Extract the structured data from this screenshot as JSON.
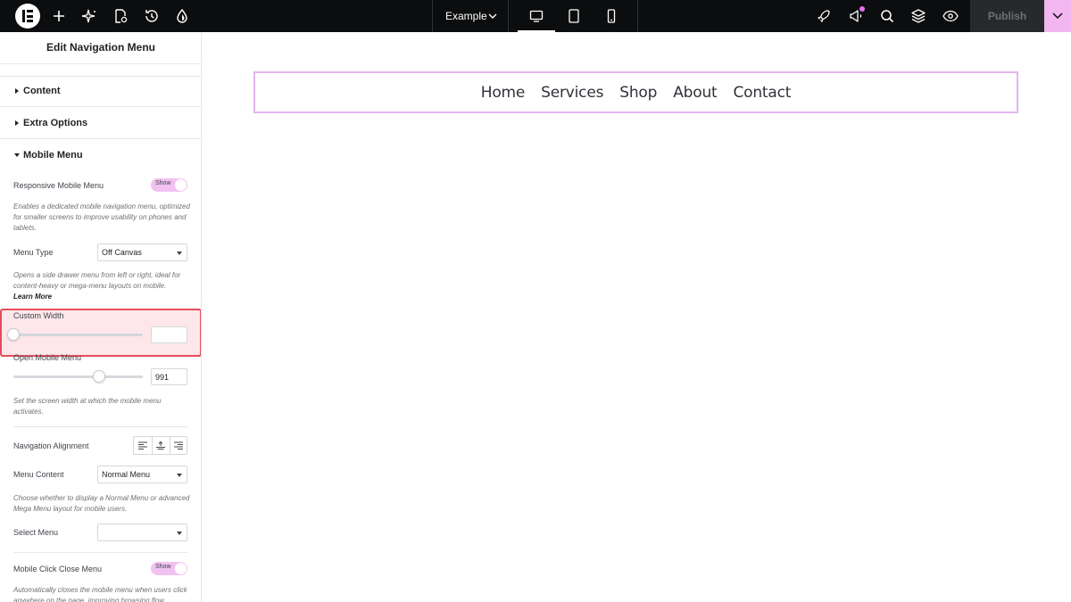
{
  "topbar": {
    "site_name": "Example",
    "publish_label": "Publish",
    "icons": [
      "elementor-logo",
      "add-icon",
      "ai-sparkle-icon",
      "page-settings-icon",
      "history-icon",
      "theme-style-icon",
      "devices: desktop, tablet, mobile",
      "launchpad-icon",
      "announcements-icon",
      "search-icon",
      "structure-icon",
      "preview-icon",
      "chevron-down-icon"
    ],
    "active_device": "desktop",
    "notification_dot_color": "#e86eec"
  },
  "panel": {
    "title": "Edit Navigation Menu",
    "sections": [
      {
        "label": "Content",
        "expanded": false
      },
      {
        "label": "Extra Options",
        "expanded": false
      },
      {
        "label": "Mobile Menu",
        "expanded": true
      }
    ],
    "responsive_mobile_menu": {
      "label": "Responsive Mobile Menu",
      "toggle": "Show",
      "description": "Enables a dedicated mobile navigation menu, optimized for smaller screens to improve usability on phones and tablets."
    },
    "menu_type": {
      "label": "Menu Type",
      "value": "Off Canvas",
      "description": "Opens a side drawer menu from left or right, ideal for content-heavy or mega-menu layouts on mobile.",
      "learn_more": "Learn More"
    },
    "custom_width": {
      "label": "Custom Width",
      "value": "",
      "slider_fraction": 0.0
    },
    "open_mobile_menu": {
      "label": "Open Mobile Menu",
      "value": "991",
      "slider_fraction": 0.66,
      "description": "Set the screen width at which the mobile menu activates."
    },
    "navigation_alignment": {
      "label": "Navigation Alignment",
      "options": [
        "align-left-icon",
        "align-center-icon",
        "align-right-icon"
      ]
    },
    "menu_content": {
      "label": "Menu Content",
      "value": "Normal Menu",
      "description": "Choose whether to display a Normal Menu or advanced Mega Menu layout for mobile users."
    },
    "select_menu": {
      "label": "Select Menu",
      "value": ""
    },
    "mobile_click_close_menu": {
      "label": "Mobile Click Close Menu",
      "toggle": "Show",
      "description": "Automatically closes the mobile menu when users click anywhere on the page, improving browsing flow"
    }
  },
  "canvas": {
    "nav_items": [
      "Home",
      "Services",
      "Shop",
      "About",
      "Contact"
    ]
  },
  "colors": {
    "topbar_bg": "#0c0d0e",
    "accent_pink": "#f2b6f0",
    "highlight_border": "#e84c5c",
    "highlight_bg": "#fde7ea",
    "widget_outline": "#e4b5ee"
  }
}
